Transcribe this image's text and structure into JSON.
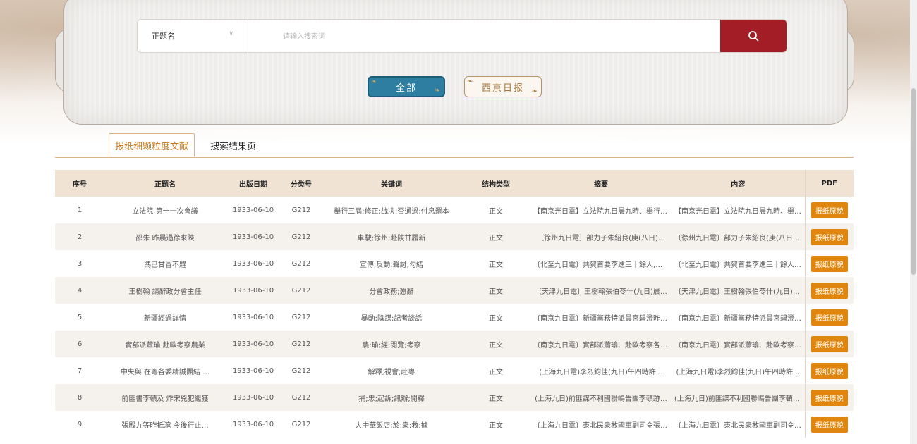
{
  "search": {
    "field_label": "正题名",
    "placeholder": "请输入搜索词"
  },
  "filters": {
    "all_label": "全部",
    "paper_label": "西京日报"
  },
  "tabs": [
    {
      "label": "报纸细颗粒度文献",
      "active": true
    },
    {
      "label": "搜索结果页",
      "active": false
    }
  ],
  "table": {
    "headers": [
      "序号",
      "正题名",
      "出版日期",
      "分类号",
      "关键词",
      "结构类型",
      "摘要",
      "内容",
      "PDF"
    ],
    "pdf_label": "报纸原貌",
    "rows": [
      {
        "no": "1",
        "title": "立法院 第十一次會議",
        "date": "1933-06-10",
        "cls": "G212",
        "keywords": "舉行三屆;修正;战决;否通過;付息還本",
        "type": "正文",
        "summary": "【南京光日電】立法院九日晨九時、舉行三…",
        "content": "【南京光日電】立法院九日晨九時、舉行三…"
      },
      {
        "no": "2",
        "title": "邵朱 昨晨過徐來陝",
        "date": "1933-06-10",
        "cls": "G212",
        "keywords": "車駛;徐州;赴陝甘履新",
        "type": "正文",
        "summary": "〔徐州九日電〕部力子朱紹良(庚(八日)…",
        "content": "〔徐州九日電〕部力子朱紹良(庚(八日)…"
      },
      {
        "no": "3",
        "title": "馮已甘冒不韙",
        "date": "1933-06-10",
        "cls": "G212",
        "keywords": "宣傳;反動;聲討;勾結",
        "type": "正文",
        "summary": "〔北至九日電〕共賀首要李進三十餘人,據…",
        "content": "〔北至九日電〕共賀首要李進三十餘人,據…"
      },
      {
        "no": "4",
        "title": "王樹翰 請辭政分會主任",
        "date": "1933-06-10",
        "cls": "G212",
        "keywords": "分會政務;懇辭",
        "type": "正文",
        "summary": "〔天津九日電〕王樹翰張伯苓什(九日)晨…",
        "content": "〔天津九日電〕王樹翰張伯苓什(九日)晨…"
      },
      {
        "no": "5",
        "title": "新疆經過詳情",
        "date": "1933-06-10",
        "cls": "G212",
        "keywords": "暴動;陰謀;記者談話",
        "type": "正文",
        "summary": "〔南京九日電〕新疆黨務特派員宮碧澄昨啟…",
        "content": "〔南京九日電〕新疆黨務特派員宮碧澄昨啟…"
      },
      {
        "no": "6",
        "title": "實部派蕭瑜 赴歐考察農業",
        "date": "1933-06-10",
        "cls": "G212",
        "keywords": "農;瑜;經;閱覽;考察",
        "type": "正文",
        "summary": "〔南京九日電〕實部派蕭瑜、赴歐考察各國…",
        "content": "〔南京九日電〕實部派蕭瑜、赴歐考察各國…"
      },
      {
        "no": "7",
        "title": "中央與 在粵各委精誠團結 …",
        "date": "1933-06-10",
        "cls": "G212",
        "keywords": "解釋;視會;赴粵",
        "type": "正文",
        "summary": "(上海九日電)李烈鈞佳(九日)午四時許…",
        "content": "(上海九日電)李烈鈞佳(九日)午四時許…"
      },
      {
        "no": "8",
        "title": "前匪書李頓及 炸宋兇犯繼獲",
        "date": "1933-06-10",
        "cls": "G212",
        "keywords": "捕;忠;起訴;訊辦;開釋",
        "type": "正文",
        "summary": "(上海九日)前匪謀不利國聯嶋告團李頓跡…",
        "content": "(上海九日)前匪謀不利國聯嶋告團李頓跡…"
      },
      {
        "no": "9",
        "title": "張殿九等昨抵滬 今後行止…",
        "date": "1933-06-10",
        "cls": "G212",
        "keywords": "大中華飯店;於;衆;救;據",
        "type": "正文",
        "summary": "〔上海九日電〕東北民衆救國軍副司令張殿…",
        "content": "〔上海九日電〕東北民衆救國軍副司令張殿…"
      }
    ]
  },
  "colors": {
    "accent_red": "#a31d26",
    "tab_active": "#c7771a",
    "pdf_button": "#e0860e",
    "header_bg": "#f1e3d4",
    "filter_all_bg": "#2d7ea0"
  }
}
